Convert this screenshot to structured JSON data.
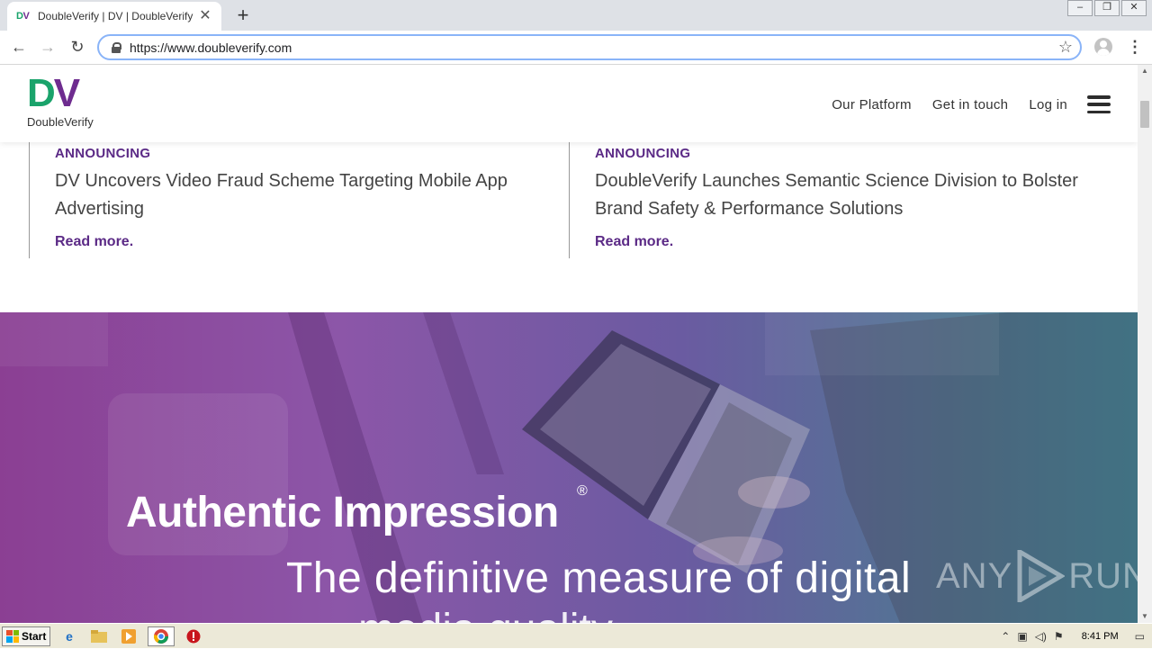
{
  "browser": {
    "tab_title": "DoubleVerify | DV | DoubleVerify",
    "tab_favicon_d": "D",
    "tab_favicon_v": "V",
    "new_tab_glyph": "+",
    "close_glyph": "✕",
    "url": "https://www.doubleverify.com",
    "window_controls": [
      "–",
      "❐",
      "✕"
    ]
  },
  "site": {
    "logo_mark_d": "D",
    "logo_mark_v": "V",
    "logo_word": "DoubleVerify",
    "nav": [
      "Our Platform",
      "Get in touch",
      "Log in"
    ],
    "colors": {
      "green": "#1aa36b",
      "purple": "#6e2c8f",
      "link": "#5b2a86"
    }
  },
  "news": [
    {
      "tag": "ANNOUNCING",
      "headline": "DV Uncovers Video Fraud Scheme Targeting Mobile App Advertising",
      "link": "Read more."
    },
    {
      "tag": "ANNOUNCING",
      "headline": "DoubleVerify Launches Semantic Science Division to Bolster Brand Safety & Performance Solutions",
      "link": "Read more."
    }
  ],
  "hero": {
    "title": "Authentic Impression",
    "registered": "®",
    "subtitle": "The definitive measure of digital",
    "subtitle_cut": "media quality"
  },
  "watermark": {
    "left": "ANY",
    "right": "RUN"
  },
  "taskbar": {
    "start_label": "Start",
    "clock": "8:41 PM",
    "icons": [
      "ie-icon",
      "folder-icon",
      "media-player-icon",
      "chrome-icon",
      "stop-icon"
    ]
  }
}
